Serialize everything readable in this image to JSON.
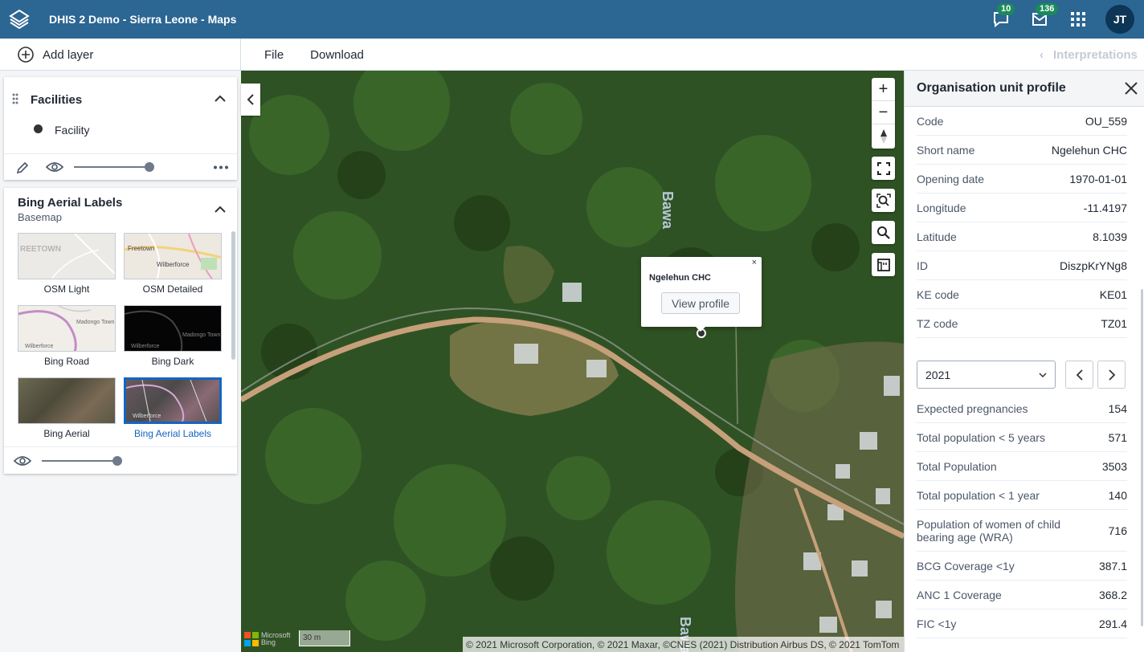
{
  "header": {
    "app_title": "DHIS 2 Demo - Sierra Leone - Maps",
    "interpretations_badge": "10",
    "messages_badge": "136",
    "avatar_initials": "JT",
    "bg_color": "#2c6693"
  },
  "toolbar": {
    "add_layer_label": "Add layer",
    "file_label": "File",
    "download_label": "Download",
    "interpretations_label": "Interpretations"
  },
  "layers": {
    "facilities": {
      "title": "Facilities",
      "legend_label": "Facility",
      "opacity": 1.0
    },
    "basemap": {
      "title": "Bing Aerial Labels",
      "subtitle": "Basemap",
      "opacity": 1.0,
      "options": [
        {
          "label": "OSM Light",
          "thumb_text": "REETOWN",
          "selected": false
        },
        {
          "label": "OSM Detailed",
          "thumb_text": "Freetown",
          "selected": false
        },
        {
          "label": "Bing Road",
          "thumb_text": "Madongo Town",
          "selected": false
        },
        {
          "label": "Bing Dark",
          "thumb_text": "Madongo Town",
          "selected": false
        },
        {
          "label": "Bing Aerial",
          "thumb_text": "",
          "selected": false
        },
        {
          "label": "Bing Aerial Labels",
          "thumb_text": "",
          "selected": true
        }
      ],
      "thumb_extra": {
        "osm_detailed_2": "Wilberforce",
        "bing_road_2": "Wilberforce",
        "bing_dark_2": "Wilberforce",
        "aerial_labels_1": "Wilberforce"
      }
    }
  },
  "map": {
    "popup": {
      "title": "Ngelehun CHC",
      "button_label": "View profile",
      "close": "×"
    },
    "labels": {
      "river_top": "Bawa",
      "river_bottom": "Bawa"
    },
    "attribution": "© 2021 Microsoft Corporation, © 2021 Maxar, ©CNES (2021) Distribution Airbus DS, © 2021 TomTom",
    "scale_label": "30 m",
    "bing_logo_text": "Microsoft Bing"
  },
  "profile": {
    "title": "Organisation unit profile",
    "attributes": [
      {
        "key": "Code",
        "value": "OU_559"
      },
      {
        "key": "Short name",
        "value": "Ngelehun CHC"
      },
      {
        "key": "Opening date",
        "value": "1970-01-01"
      },
      {
        "key": "Longitude",
        "value": "-11.4197"
      },
      {
        "key": "Latitude",
        "value": "8.1039"
      },
      {
        "key": "ID",
        "value": "DiszpKrYNg8"
      },
      {
        "key": "KE code",
        "value": "KE01"
      },
      {
        "key": "TZ code",
        "value": "TZ01"
      }
    ],
    "year": "2021",
    "data": [
      {
        "key": "Expected pregnancies",
        "value": "154"
      },
      {
        "key": "Total population < 5 years",
        "value": "571"
      },
      {
        "key": "Total Population",
        "value": "3503"
      },
      {
        "key": "Total population < 1 year",
        "value": "140"
      },
      {
        "key": "Population of women of child bearing age (WRA)",
        "value": "716"
      },
      {
        "key": "BCG Coverage <1y",
        "value": "387.1"
      },
      {
        "key": "ANC 1 Coverage",
        "value": "368.2"
      },
      {
        "key": "FIC <1y",
        "value": "291.4"
      }
    ]
  }
}
